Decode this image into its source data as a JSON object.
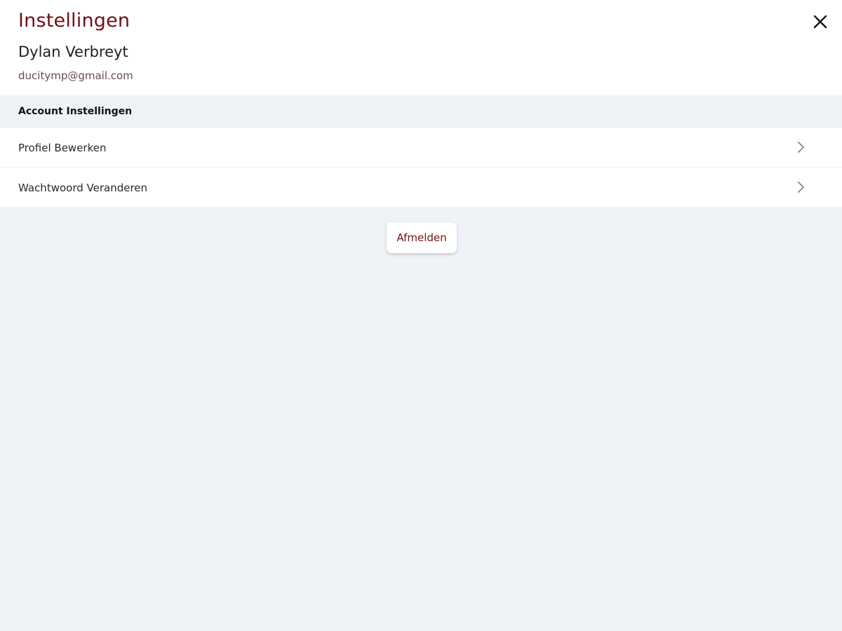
{
  "header": {
    "title": "Instellingen",
    "close_icon": "close-icon"
  },
  "user": {
    "name": "Dylan Verbreyt",
    "email": "ducitymp@gmail.com"
  },
  "account_section": {
    "title": "Account Instellingen",
    "items": [
      {
        "label": "Profiel Bewerken",
        "icon": "chevron-right-icon"
      },
      {
        "label": "Wachtwoord Veranderen",
        "icon": "chevron-right-icon"
      }
    ]
  },
  "logout": {
    "label": "Afmelden"
  },
  "colors": {
    "accent": "#6f1019",
    "background": "#eff3f7",
    "surface": "#ffffff"
  }
}
